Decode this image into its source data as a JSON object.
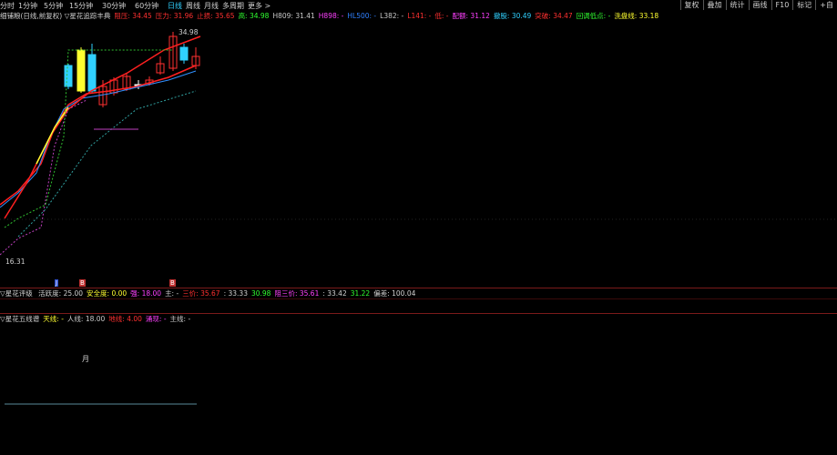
{
  "tabs": [
    {
      "label": "分时",
      "active": false
    },
    {
      "label": "1分钟",
      "active": false
    },
    {
      "label": "5分钟",
      "active": false
    },
    {
      "label": "15分钟",
      "active": false
    },
    {
      "label": "30分钟",
      "active": false
    },
    {
      "label": "60分钟",
      "active": false
    },
    {
      "label": "日线",
      "active": true
    },
    {
      "label": "周线",
      "active": false
    },
    {
      "label": "月线",
      "active": false
    },
    {
      "label": "多周期",
      "active": false
    },
    {
      "label": "更多 >",
      "active": false
    }
  ],
  "right_buttons": [
    "复权",
    "叠加",
    "统计",
    "画线",
    "F10",
    "标记",
    "+自"
  ],
  "main_info": [
    {
      "text": "细铺粮(日线,前复权) ▽星花追踪丰典",
      "color": "#d0d0d0"
    },
    {
      "text": "阻压: 34.45",
      "color": "#ff3030"
    },
    {
      "text": "压力: 31.96",
      "color": "#ff3030"
    },
    {
      "text": "止损: 35.65",
      "color": "#ff3030"
    },
    {
      "text": "高: 34.98",
      "color": "#30ff30"
    },
    {
      "text": "H809: 31.41",
      "color": "#c8c8c8"
    },
    {
      "text": "H898: -",
      "color": "#ff40ff"
    },
    {
      "text": "HL500: -",
      "color": "#3080ff"
    },
    {
      "text": "L382: -",
      "color": "#c8c8c8"
    },
    {
      "text": "L141: -",
      "color": "#ff3030"
    },
    {
      "text": "低: -",
      "color": "#ff3030"
    },
    {
      "text": "配额: 31.12",
      "color": "#ff40ff"
    },
    {
      "text": "撤股: 30.49",
      "color": "#30d0ff"
    },
    {
      "text": "突破: 34.47",
      "color": "#ff3030"
    },
    {
      "text": "回调低点: -",
      "color": "#30ff30"
    },
    {
      "text": "洗盘线: 33.18",
      "color": "#ffff30"
    }
  ],
  "price_labels": {
    "high": "34.98",
    "low": "16.31"
  },
  "panel2_info": [
    {
      "text": "▽星花评级 ",
      "color": "#d0d0d0"
    },
    {
      "text": "活跃度: 25.00",
      "color": "#d0d0d0"
    },
    {
      "text": "安全度: 0.00",
      "color": "#ffff30"
    },
    {
      "text": "强: 18.00",
      "color": "#ff40ff"
    },
    {
      "text": "主: -",
      "color": "#d0d0d0"
    },
    {
      "text": "三价: 35.67",
      "color": "#ff3030"
    },
    {
      "text": ": 33.33",
      "color": "#d0d0d0"
    },
    {
      "text": "30.98",
      "color": "#30ff30"
    },
    {
      "text": "阻三价: 35.61",
      "color": "#ff40ff"
    },
    {
      "text": ": 33.42",
      "color": "#d0d0d0"
    },
    {
      "text": "31.22",
      "color": "#30ff30"
    },
    {
      "text": "偏差: 100.04",
      "color": "#d0d0d0"
    }
  ],
  "panel3_info": [
    {
      "text": "▽星花五线谱",
      "color": "#d0d0d0"
    },
    {
      "text": "天线: -",
      "color": "#ffff30"
    },
    {
      "text": "人线: 18.00",
      "color": "#c8c8c8"
    },
    {
      "text": "地线: 4.00",
      "color": "#ff3030"
    },
    {
      "text": "涌现: -",
      "color": "#ff40ff"
    },
    {
      "text": "主线: -",
      "color": "#d0d0d0"
    }
  ],
  "markers_row": [
    "J",
    "B",
    "B"
  ],
  "panel3_label": "月",
  "colors": {
    "up": "#ff3030",
    "down": "#30d0ff",
    "ma1": "#ff2020",
    "ma2": "#3090ff",
    "ma3": "#ffff30"
  }
}
